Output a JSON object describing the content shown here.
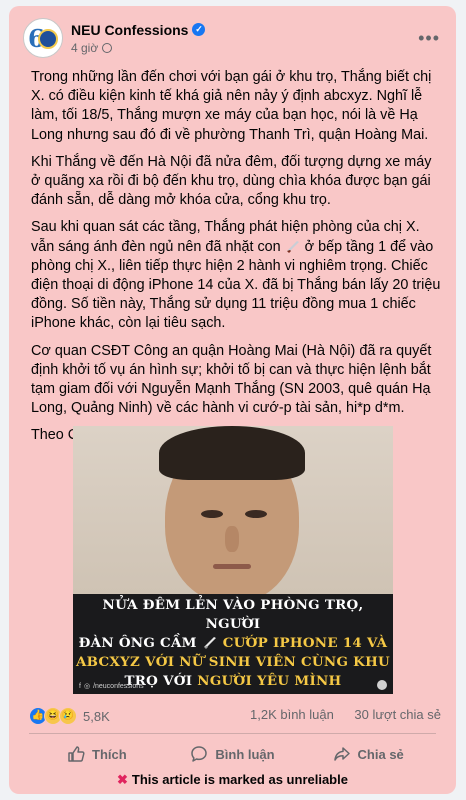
{
  "post": {
    "page_name": "NEU Confessions",
    "time": "4 giờ",
    "paragraphs": [
      [
        "Trong những lần đến chơi với bạn gái ở khu trọ, Thắng biết chị X. có điều kiện kinh tế khá giả nên nảy ý định abcxyz. Nghĩ lễ làm, tối 18/5, Thắng mượn xe máy của bạn học, nói là về Hạ Long nhưng sau đó đi về phường Thanh Trì, quận Hoàng Mai."
      ],
      [
        "Khi Thắng về đến Hà Nội đã nửa đêm, đối tượng dựng xe máy ở quãng xa rồi đi bộ đến khu trọ, dùng chìa khóa được bạn gái đánh sẵn, dễ dàng mở khóa cửa, cổng khu trọ."
      ],
      [
        "Sau khi quan sát các tầng, Thắng phát hiện phòng của chị X. vẫn sáng ánh đèn ngủ nên đã nhặt con ",
        " ở bếp tầng 1 để vào phòng chị X., liên tiếp thực hiện 2 hành vi nghiêm trọng. Chiếc điện thoại di động iPhone 14 của X. đã bị Thắng bán lấy 20 triệu đồng. Số tiền này, Thắng sử dụng 11 triệu đồng mua 1 chiếc iPhone khác, còn lại tiêu sạch."
      ],
      [
        "Cơ quan CSĐT Công an quận Hoàng Mai (Hà Nội) đã ra quyết định khởi tố vụ án hình sự; khởi tố bị can và thực hiện lệnh bắt tạm giam đối với Nguyễn Mạnh Thắng (SN 2003, quê quán Hạ Long, Quảng Ninh) về các hành vi cướ-p tài sản, hi*p d*m."
      ],
      [
        "Theo CAND"
      ]
    ]
  },
  "image": {
    "caption": {
      "line1": "NỬA ĐÊM LẺN VÀO PHÒNG TRỌ, NGƯỜI",
      "line2a": "ĐÀN ÔNG CẦM ",
      "line2b": " CƯỚP IPHONE 14 VÀ",
      "line3": "ABCXYZ VỚI NỮ SINH VIÊN CÙNG KHU",
      "line4a": "TRỌ VỚI ",
      "line4b": "NGƯỜI YÊU MÌNH"
    },
    "footer_handle": "/neuconfessions"
  },
  "stats": {
    "reactions": "5,8K",
    "comments": "1,2K bình luận",
    "shares": "30 lượt chia sẻ"
  },
  "actions": {
    "like": "Thích",
    "comment": "Bình luận",
    "share": "Chia sẻ"
  },
  "notice": "This article is marked as unreliable",
  "colors": {
    "card_bg": "#f9c7c7",
    "highlight": "#f5c845",
    "verified": "#1877f2"
  }
}
